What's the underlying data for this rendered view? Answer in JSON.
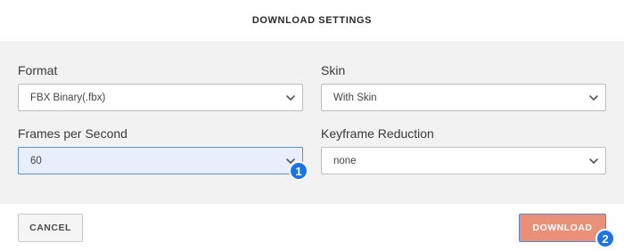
{
  "dialog": {
    "title": "DOWNLOAD SETTINGS"
  },
  "fields": {
    "format": {
      "label": "Format",
      "value": "FBX Binary(.fbx)"
    },
    "skin": {
      "label": "Skin",
      "value": "With Skin"
    },
    "fps": {
      "label": "Frames per Second",
      "value": "60"
    },
    "keyframe": {
      "label": "Keyframe Reduction",
      "value": "none"
    }
  },
  "buttons": {
    "cancel_label": "CANCEL",
    "download_label": "DOWNLOAD"
  },
  "badges": {
    "one": "1",
    "two": "2"
  },
  "icons": {
    "select_arrow": "chevron-down-icon"
  },
  "colors": {
    "download_bg": "#ea9078",
    "badge_bg": "#1a73e8",
    "focused_bg": "#e8eefb"
  }
}
